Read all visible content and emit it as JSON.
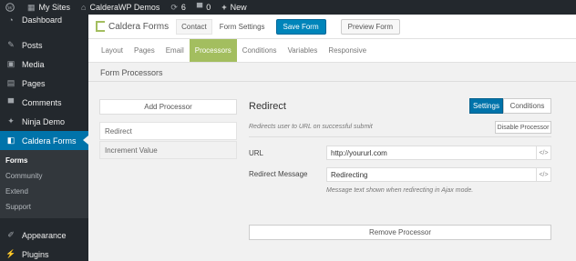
{
  "admin_bar": {
    "my_sites": "My Sites",
    "site_name": "CalderaWP Demos",
    "updates_count": "6",
    "comments_count": "0",
    "new_label": "New"
  },
  "sidebar": {
    "items_top": [
      {
        "label": "Dashboard",
        "icon": "dashboard-icon"
      }
    ],
    "items_mid": [
      {
        "label": "Posts",
        "icon": "pin-icon"
      },
      {
        "label": "Media",
        "icon": "media-icon"
      },
      {
        "label": "Pages",
        "icon": "pages-icon"
      },
      {
        "label": "Comments",
        "icon": "comments-icon"
      },
      {
        "label": "Ninja Demo",
        "icon": "ninja-icon"
      }
    ],
    "active": {
      "label": "Caldera Forms",
      "icon": "caldera-icon"
    },
    "submenu": [
      "Forms",
      "Community",
      "Extend",
      "Support"
    ],
    "items_bottom": [
      {
        "label": "Appearance",
        "icon": "appearance-icon"
      },
      {
        "label": "Plugins",
        "icon": "plugins-icon"
      }
    ]
  },
  "header": {
    "brand": "Caldera Forms",
    "form_name": "Contact",
    "form_settings": "Form Settings",
    "save_label": "Save Form",
    "preview_label": "Preview Form"
  },
  "nav": {
    "tabs": [
      "Layout",
      "Pages",
      "Email",
      "Processors",
      "Conditions",
      "Variables",
      "Responsive"
    ],
    "active_index": 3
  },
  "section": {
    "title": "Form Processors"
  },
  "processors": {
    "add_label": "Add Processor",
    "items": [
      "Redirect",
      "Increment Value"
    ]
  },
  "config": {
    "title": "Redirect",
    "settings_toggle": "Settings",
    "conditions_toggle": "Conditions",
    "description": "Redirects user to URL on successful submit",
    "disable_label": "Disable Processor",
    "url_label": "URL",
    "url_value": "http://yoururl.com",
    "message_label": "Redirect Message",
    "message_value": "Redirecting",
    "message_help": "Message text shown when redirecting in Ajax mode.",
    "magic_tag": "</>",
    "remove_label": "Remove Processor"
  },
  "colors": {
    "accent_green": "#a3be5f",
    "wp_blue": "#0073aa",
    "admin_dark": "#23282d"
  }
}
